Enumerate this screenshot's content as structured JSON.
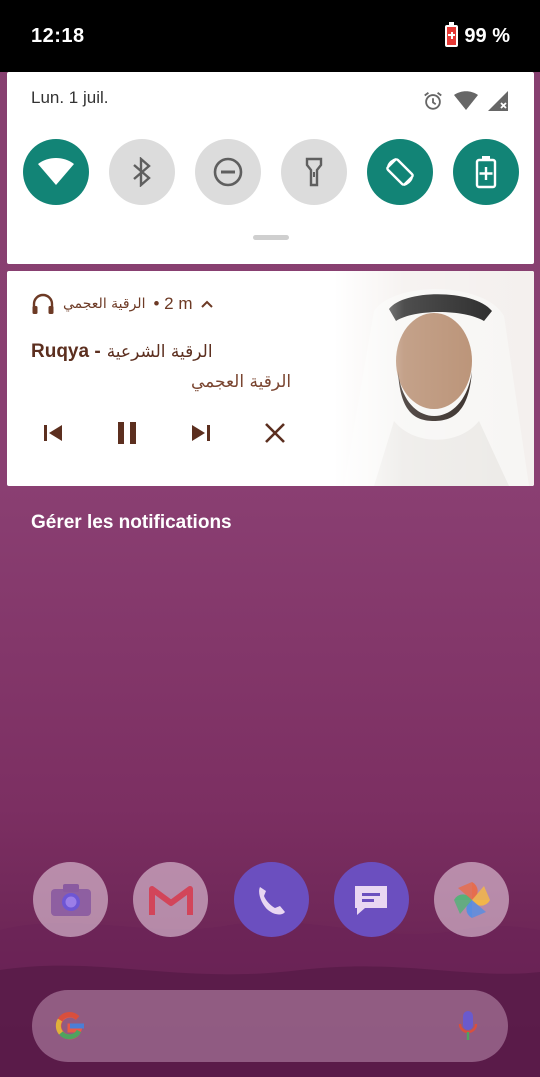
{
  "status_bar": {
    "time": "12:18",
    "battery": "99 %"
  },
  "quick_settings": {
    "date": "Lun. 1 juil.",
    "tiles": [
      {
        "icon": "wifi-icon",
        "state": "on"
      },
      {
        "icon": "bluetooth-icon",
        "state": "off"
      },
      {
        "icon": "do-not-disturb-icon",
        "state": "off"
      },
      {
        "icon": "flashlight-icon",
        "state": "off"
      },
      {
        "icon": "auto-rotate-icon",
        "state": "on"
      },
      {
        "icon": "battery-saver-icon",
        "state": "on"
      }
    ]
  },
  "notification": {
    "app_name": "الرقية العجمي",
    "time": "• 2 m",
    "title_en": "Ruqya -",
    "title_ar": "الرقية الشرعية",
    "artist": "الرقية العجمي"
  },
  "manage_label": "Gérer les notifications",
  "dock": [
    "camera-icon",
    "gmail-icon",
    "phone-icon",
    "messages-icon",
    "photos-icon"
  ],
  "colors": {
    "accent": "#128476",
    "notif_text": "#5c2f1f"
  }
}
